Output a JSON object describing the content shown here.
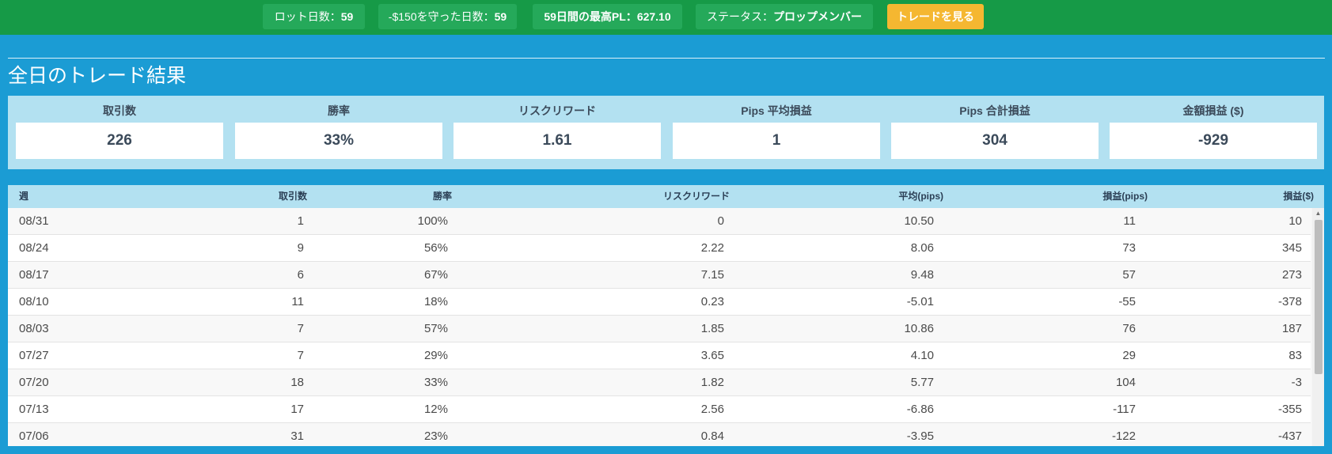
{
  "topbar": {
    "lot_days": {
      "label": "ロット日数：",
      "value": "59"
    },
    "protect_days": {
      "label": "-$150を守った日数：",
      "value": "59"
    },
    "max_pl": {
      "label": "59日間の最高PL：",
      "value": "627.10"
    },
    "status": {
      "label": "ステータス：",
      "value": "プロップメンバー"
    },
    "view_trades_button": "トレードを見る"
  },
  "section_title": "全日のトレード結果",
  "summary": [
    {
      "label": "取引数",
      "value": "226"
    },
    {
      "label": "勝率",
      "value": "33%"
    },
    {
      "label": "リスクリワード",
      "value": "1.61"
    },
    {
      "label": "Pips 平均損益",
      "value": "1"
    },
    {
      "label": "Pips 合計損益",
      "value": "304"
    },
    {
      "label": "金額損益 ($)",
      "value": "-929"
    }
  ],
  "table": {
    "headers": [
      "週",
      "取引数",
      "勝率",
      "リスクリワード",
      "平均(pips)",
      "損益(pips)",
      "損益($)"
    ],
    "rows": [
      [
        "08/31",
        "1",
        "100%",
        "0",
        "10.50",
        "11",
        "10"
      ],
      [
        "08/24",
        "9",
        "56%",
        "2.22",
        "8.06",
        "73",
        "345"
      ],
      [
        "08/17",
        "6",
        "67%",
        "7.15",
        "9.48",
        "57",
        "273"
      ],
      [
        "08/10",
        "11",
        "18%",
        "0.23",
        "-5.01",
        "-55",
        "-378"
      ],
      [
        "08/03",
        "7",
        "57%",
        "1.85",
        "10.86",
        "76",
        "187"
      ],
      [
        "07/27",
        "7",
        "29%",
        "3.65",
        "4.10",
        "29",
        "83"
      ],
      [
        "07/20",
        "18",
        "33%",
        "1.82",
        "5.77",
        "104",
        "-3"
      ],
      [
        "07/13",
        "17",
        "12%",
        "2.56",
        "-6.86",
        "-117",
        "-355"
      ],
      [
        "07/06",
        "31",
        "23%",
        "0.84",
        "-3.95",
        "-122",
        "-437"
      ]
    ]
  },
  "colors": {
    "topbar": "#169a47",
    "pill": "#25a95a",
    "button": "#f5b731",
    "page_background": "#1b9cd4",
    "panel": "#b3e1f1"
  },
  "icons": {
    "scroll_up": "scroll-up-arrow-icon"
  }
}
